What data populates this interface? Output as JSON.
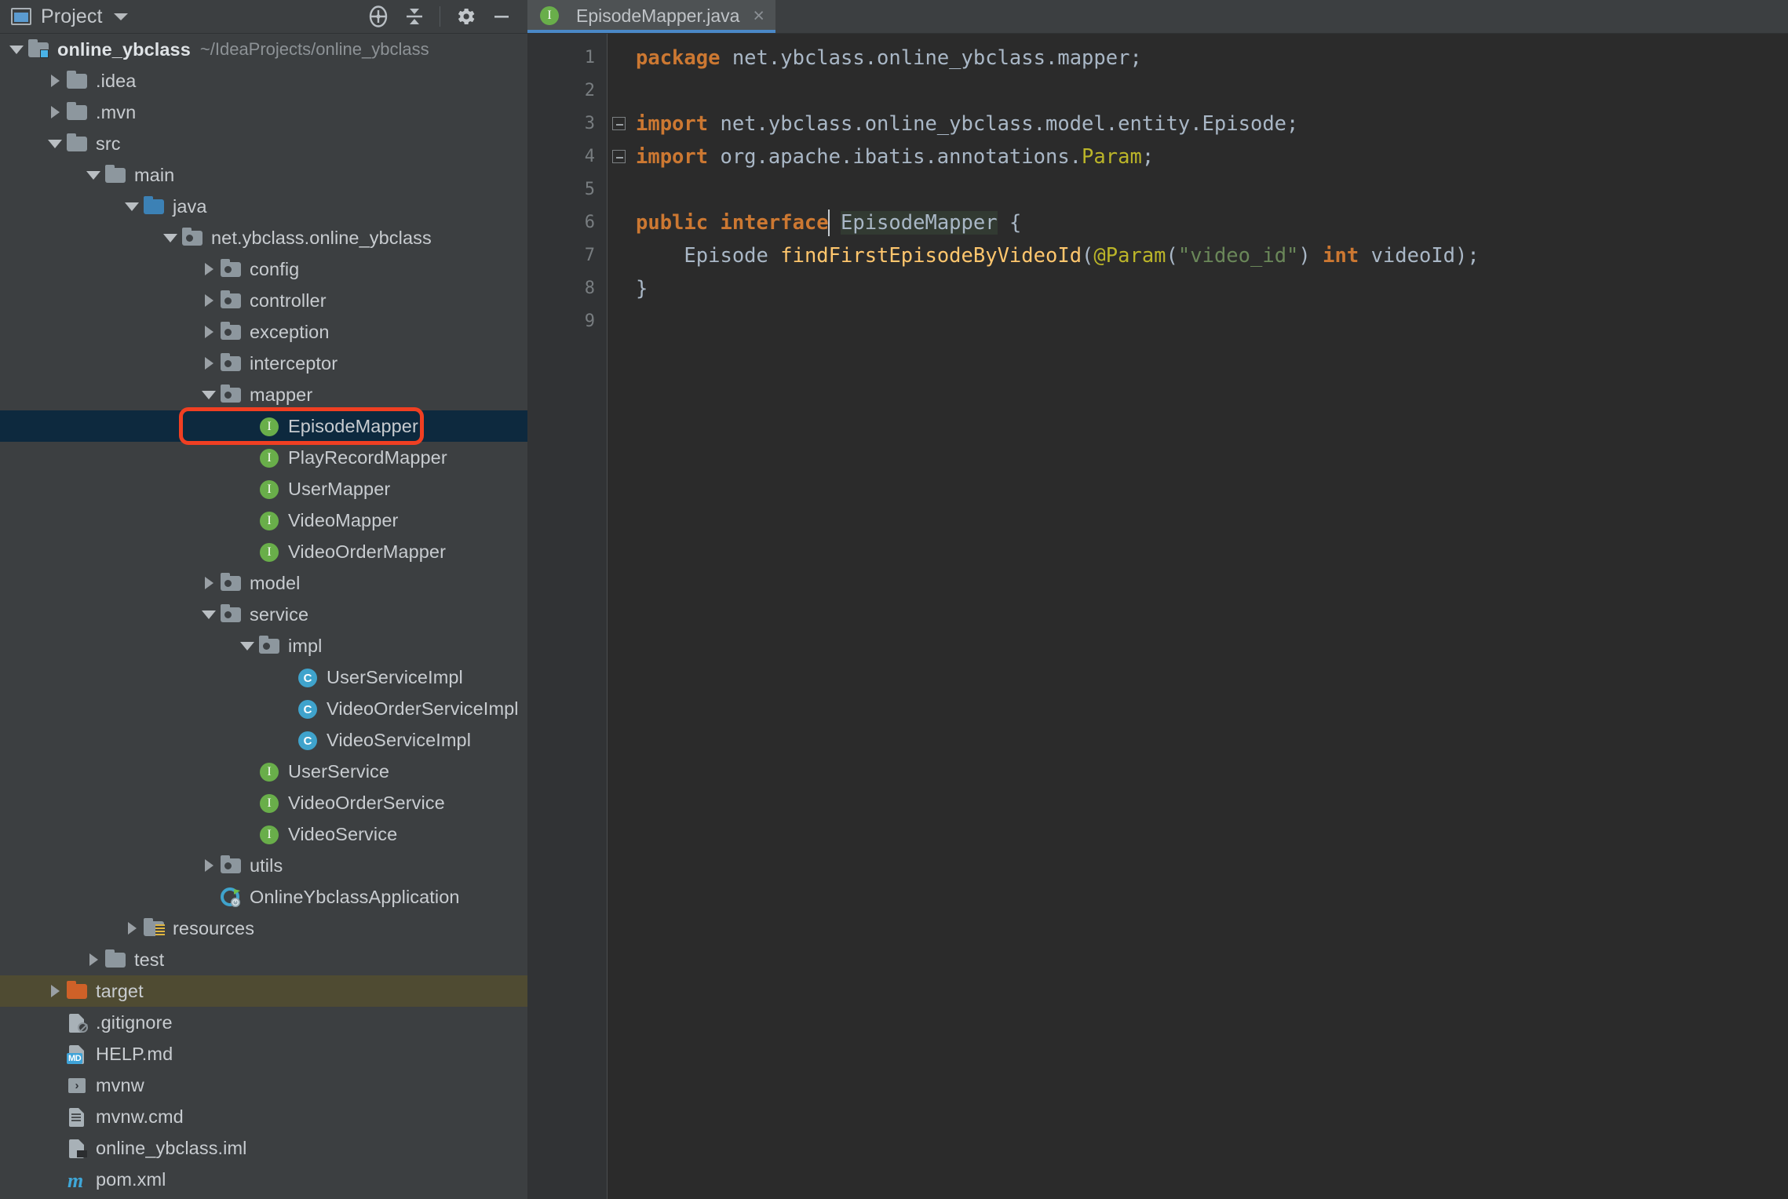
{
  "window": {
    "panel_title": "Project",
    "toolbar": {
      "locate_icon": "crosshair-target-icon",
      "collapse_icon": "collapse-all-icon",
      "settings_icon": "gear-icon",
      "hide_icon": "minimize-icon"
    }
  },
  "tabs": [
    {
      "label": "EpisodeMapper.java",
      "icon": "interface-icon",
      "close": "×",
      "active": true
    }
  ],
  "tree": {
    "items": [
      {
        "label": "online_ybclass",
        "path": "~/IdeaProjects/online_ybclass",
        "indent": 0,
        "arrow": "down",
        "icon": "folder-project",
        "bold": true
      },
      {
        "label": ".idea",
        "indent": 1,
        "arrow": "right",
        "icon": "folder-gray"
      },
      {
        "label": ".mvn",
        "indent": 1,
        "arrow": "right",
        "icon": "folder-gray"
      },
      {
        "label": "src",
        "indent": 1,
        "arrow": "down",
        "icon": "folder-gray"
      },
      {
        "label": "main",
        "indent": 2,
        "arrow": "down",
        "icon": "folder-gray"
      },
      {
        "label": "java",
        "indent": 3,
        "arrow": "down",
        "icon": "folder-blue"
      },
      {
        "label": "net.ybclass.online_ybclass",
        "indent": 4,
        "arrow": "down",
        "icon": "folder-package"
      },
      {
        "label": "config",
        "indent": 5,
        "arrow": "right",
        "icon": "folder-package"
      },
      {
        "label": "controller",
        "indent": 5,
        "arrow": "right",
        "icon": "folder-package"
      },
      {
        "label": "exception",
        "indent": 5,
        "arrow": "right",
        "icon": "folder-package"
      },
      {
        "label": "interceptor",
        "indent": 5,
        "arrow": "right",
        "icon": "folder-package"
      },
      {
        "label": "mapper",
        "indent": 5,
        "arrow": "down",
        "icon": "folder-package"
      },
      {
        "label": "EpisodeMapper",
        "indent": 6,
        "arrow": "none",
        "icon": "interface-icon",
        "selected": true,
        "highlighted": true
      },
      {
        "label": "PlayRecordMapper",
        "indent": 6,
        "arrow": "none",
        "icon": "interface-icon"
      },
      {
        "label": "UserMapper",
        "indent": 6,
        "arrow": "none",
        "icon": "interface-icon"
      },
      {
        "label": "VideoMapper",
        "indent": 6,
        "arrow": "none",
        "icon": "interface-icon"
      },
      {
        "label": "VideoOrderMapper",
        "indent": 6,
        "arrow": "none",
        "icon": "interface-icon"
      },
      {
        "label": "model",
        "indent": 5,
        "arrow": "right",
        "icon": "folder-package"
      },
      {
        "label": "service",
        "indent": 5,
        "arrow": "down",
        "icon": "folder-package"
      },
      {
        "label": "impl",
        "indent": 6,
        "arrow": "down",
        "icon": "folder-package"
      },
      {
        "label": "UserServiceImpl",
        "indent": 7,
        "arrow": "none",
        "icon": "class-icon"
      },
      {
        "label": "VideoOrderServiceImpl",
        "indent": 7,
        "arrow": "none",
        "icon": "class-icon"
      },
      {
        "label": "VideoServiceImpl",
        "indent": 7,
        "arrow": "none",
        "icon": "class-icon"
      },
      {
        "label": "UserService",
        "indent": 6,
        "arrow": "none",
        "icon": "interface-icon"
      },
      {
        "label": "VideoOrderService",
        "indent": 6,
        "arrow": "none",
        "icon": "interface-icon"
      },
      {
        "label": "VideoService",
        "indent": 6,
        "arrow": "none",
        "icon": "interface-icon"
      },
      {
        "label": "utils",
        "indent": 5,
        "arrow": "right",
        "icon": "folder-package"
      },
      {
        "label": "OnlineYbclassApplication",
        "indent": 5,
        "arrow": "none",
        "icon": "spring-boot-icon"
      },
      {
        "label": "resources",
        "indent": 3,
        "arrow": "right",
        "icon": "folder-resources"
      },
      {
        "label": "test",
        "indent": 2,
        "arrow": "right",
        "icon": "folder-gray"
      },
      {
        "label": "target",
        "indent": 1,
        "arrow": "right",
        "icon": "folder-orange",
        "excluded": true
      },
      {
        "label": ".gitignore",
        "indent": 1,
        "arrow": "none",
        "icon": "file-gitignore"
      },
      {
        "label": "HELP.md",
        "indent": 1,
        "arrow": "none",
        "icon": "file-markdown"
      },
      {
        "label": "mvnw",
        "indent": 1,
        "arrow": "none",
        "icon": "file-shell"
      },
      {
        "label": "mvnw.cmd",
        "indent": 1,
        "arrow": "none",
        "icon": "file-text"
      },
      {
        "label": "online_ybclass.iml",
        "indent": 1,
        "arrow": "none",
        "icon": "file-iml"
      },
      {
        "label": "pom.xml",
        "indent": 1,
        "arrow": "none",
        "icon": "file-maven"
      }
    ]
  },
  "editor": {
    "line_numbers": [
      "1",
      "2",
      "3",
      "4",
      "5",
      "6",
      "7",
      "8",
      "9"
    ],
    "lines": [
      {
        "n": 1,
        "tokens": [
          {
            "t": "package ",
            "c": "kw"
          },
          {
            "t": "net.ybclass.online_ybclass.mapper",
            "c": "ident"
          },
          {
            "t": ";",
            "c": "ident"
          }
        ]
      },
      {
        "n": 2,
        "tokens": []
      },
      {
        "n": 3,
        "fold": "minus",
        "tokens": [
          {
            "t": "import ",
            "c": "kw"
          },
          {
            "t": "net.ybclass.online_ybclass.model.entity.Episode",
            "c": "ident"
          },
          {
            "t": ";",
            "c": "ident"
          }
        ]
      },
      {
        "n": 4,
        "fold": "minus",
        "tokens": [
          {
            "t": "import ",
            "c": "kw"
          },
          {
            "t": "org.apache.ibatis.annotations.",
            "c": "ident"
          },
          {
            "t": "Param",
            "c": "annot"
          },
          {
            "t": ";",
            "c": "ident"
          }
        ]
      },
      {
        "n": 5,
        "tokens": []
      },
      {
        "n": 6,
        "caret": true,
        "tokens": [
          {
            "t": "public ",
            "c": "kw"
          },
          {
            "t": "interface ",
            "c": "kw"
          },
          {
            "t": "EpisodeMapper",
            "c": "ident hl"
          },
          {
            "t": " {",
            "c": "ident"
          }
        ]
      },
      {
        "n": 7,
        "tokens": [
          {
            "t": "    Episode ",
            "c": "ident"
          },
          {
            "t": "findFirstEpisodeByVideoId",
            "c": "method"
          },
          {
            "t": "(",
            "c": "ident"
          },
          {
            "t": "@Param",
            "c": "annot"
          },
          {
            "t": "(",
            "c": "ident"
          },
          {
            "t": "\"video_id\"",
            "c": "str"
          },
          {
            "t": ") ",
            "c": "ident"
          },
          {
            "t": "int ",
            "c": "kw"
          },
          {
            "t": "videoId",
            "c": "ident"
          },
          {
            "t": ");",
            "c": "ident"
          }
        ]
      },
      {
        "n": 8,
        "tokens": [
          {
            "t": "}",
            "c": "ident"
          }
        ]
      },
      {
        "n": 9,
        "tokens": []
      }
    ]
  },
  "colors": {
    "accent_tab_underline": "#4a88c7",
    "selection_bg": "#0d293e",
    "excluded_bg": "#4f4b32",
    "highlight_box": "#f03f22",
    "keyword": "#cc7832",
    "method": "#ffc66d",
    "string": "#6a8759",
    "annotation": "#bbb529",
    "identifier": "#a9b7c6",
    "editor_bg": "#2b2b2b",
    "panel_bg": "#3c3f41"
  }
}
